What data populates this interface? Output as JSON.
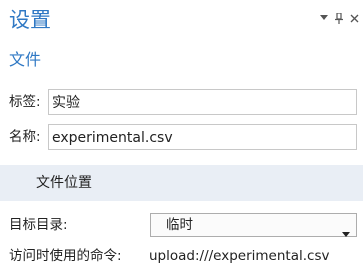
{
  "panel": {
    "title": "设置",
    "subtitle": "文件",
    "controls": {
      "dropdown_icon": "chevron-down-icon",
      "pin_icon": "pin-icon",
      "close_icon": "close-icon"
    }
  },
  "fields": {
    "tag_label": "标签:",
    "tag_value": "实验",
    "name_label": "名称:",
    "name_value": "experimental.csv"
  },
  "location_section": {
    "title": "文件位置",
    "target_dir_label": "目标目录:",
    "target_dir_value": "临时",
    "command_label": "访问时使用的命令:",
    "command_value": "upload:///experimental.csv"
  },
  "colors": {
    "accent": "#2f78c4",
    "section_bg": "#e9eef5",
    "border": "#c8c8c8"
  }
}
